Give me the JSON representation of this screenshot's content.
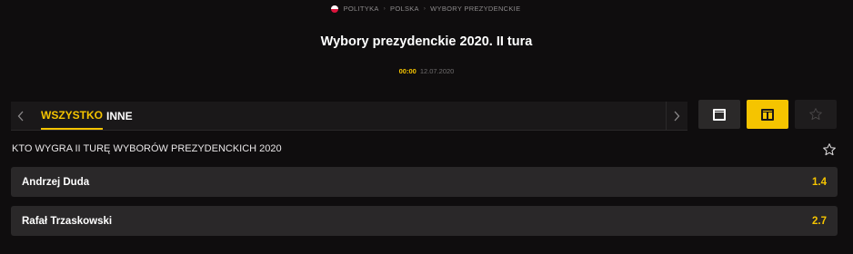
{
  "breadcrumb": {
    "items": [
      "POLITYKA",
      "POLSKA",
      "WYBORY PREZYDENCKIE"
    ],
    "separator": "›"
  },
  "event": {
    "title": "Wybory prezydenckie 2020. II tura",
    "time": "00:00",
    "date": "12.07.2020"
  },
  "tabs": {
    "prev_icon": "chevron-left-icon",
    "next_icon": "chevron-right-icon",
    "items": [
      {
        "label": "WSZYSTKO",
        "active": true
      },
      {
        "label": "INNE",
        "active": false
      }
    ]
  },
  "view_controls": {
    "single_icon": "single-column-icon",
    "double_icon": "double-column-icon",
    "favorite_icon": "star-outline-icon",
    "selected": "double"
  },
  "market": {
    "title": "KTO WYGRA II TURĘ WYBORÓW PREZYDENCKICH 2020",
    "favorite_icon": "star-outline-icon",
    "selections": [
      {
        "name": "Andrzej Duda",
        "odds": "1.4"
      },
      {
        "name": "Rafał Trzaskowski",
        "odds": "2.7"
      }
    ]
  },
  "colors": {
    "background": "#0f0d0e",
    "accent": "#f5c400",
    "row": "#2a2829"
  }
}
